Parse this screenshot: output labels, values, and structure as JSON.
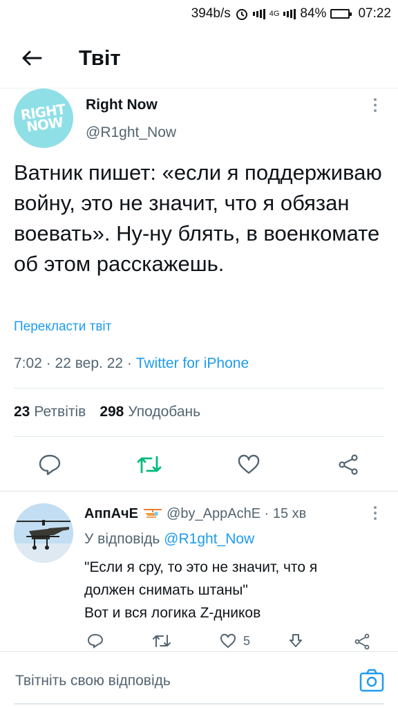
{
  "status_bar": {
    "speed": "394b/s",
    "network": "4G",
    "battery": "84%",
    "battery_level": 0.84,
    "time": "07:22"
  },
  "header": {
    "title": "Твіт"
  },
  "tweet": {
    "avatar_logo_line1": "RIGHT",
    "avatar_logo_line2": "NOW",
    "author_name": "Right Now",
    "author_handle": "@R1ght_Now",
    "text": "Ватник пишет: «если я поддерживаю войну, это не значит, что я обязан воевать». Ну-ну блять, в военкомате об этом расскажешь.",
    "translate_label": "Перекласти твіт",
    "time": "7:02",
    "date": "22 вер. 22",
    "source": "Twitter for iPhone",
    "retweets_count": "23",
    "retweets_label": "Ретвітів",
    "likes_count": "298",
    "likes_label": "Уподобань"
  },
  "reply": {
    "author_name": "АппАчЕ",
    "author_handle": "@by_AppAchE",
    "time_ago": "15 хв",
    "reply_prefix": "У відповідь",
    "reply_mention": "@R1ght_Now",
    "text_line1": "\"Если я сру, то это не значит, что я",
    "text_line2": "должен снимать штаны\"",
    "text_line3": "Вот и вся логика Z-дников",
    "likes_count": "5"
  },
  "compose": {
    "placeholder": "Твітніть свою відповідь"
  },
  "colors": {
    "accent": "#1d9bf0",
    "retweet_green": "#00ba7c",
    "text_primary": "#0f1419",
    "text_secondary": "#536471"
  }
}
